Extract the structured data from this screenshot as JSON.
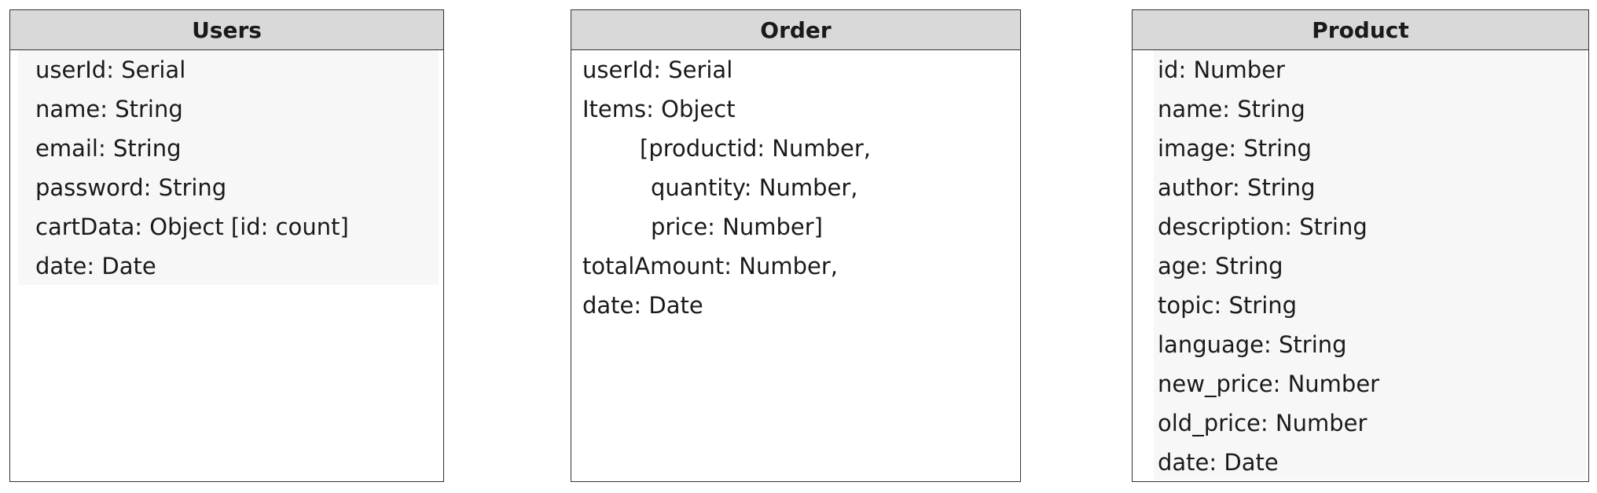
{
  "entities": [
    {
      "title": "Users",
      "fields": [
        "userId: Serial",
        "name: String",
        "email: String",
        "password: String",
        "cartData: Object [id: count]",
        "date: Date"
      ]
    },
    {
      "title": "Order",
      "fields": [
        "userId: Serial",
        "Items: Object",
        "[productid: Number,",
        "quantity: Number,",
        "price: Number]",
        "totalAmount: Number,",
        "date: Date"
      ]
    },
    {
      "title": "Product",
      "fields": [
        "id: Number",
        "name: String",
        "image: String",
        "author: String",
        "description: String",
        "age: String",
        "topic: String",
        "language: String",
        "new_price: Number",
        "old_price: Number",
        "date: Date"
      ]
    }
  ]
}
